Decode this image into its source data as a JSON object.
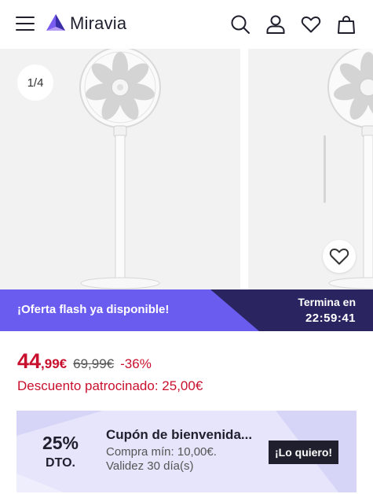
{
  "header": {
    "logo_text": "Miravia",
    "icons": [
      "menu-icon",
      "search-icon",
      "account-icon",
      "wishlist-icon",
      "cart-icon"
    ]
  },
  "gallery": {
    "counter": "1/4"
  },
  "flash": {
    "label": "¡Oferta flash ya disponible!",
    "ends_label": "Termina en",
    "countdown": "22:59:41"
  },
  "price": {
    "integer": "44",
    "decimal": ",99€",
    "original": "69,99€",
    "discount_pct": "-36%",
    "sponsored": "Descuento patrocinado: 25,00€"
  },
  "coupon": {
    "percent": "25%",
    "dto": "DTO.",
    "title": "Cupón de bienvenida...",
    "min_purchase": "Compra mín: 10,00€.",
    "validity": "Validez 30 día(s)",
    "button": "¡Lo quiero!"
  },
  "colors": {
    "brand_purple": "#6b5cf0",
    "dark_navy": "#2a2560",
    "price_red": "#c8102e",
    "coupon_bg": "#e6e5fb"
  }
}
